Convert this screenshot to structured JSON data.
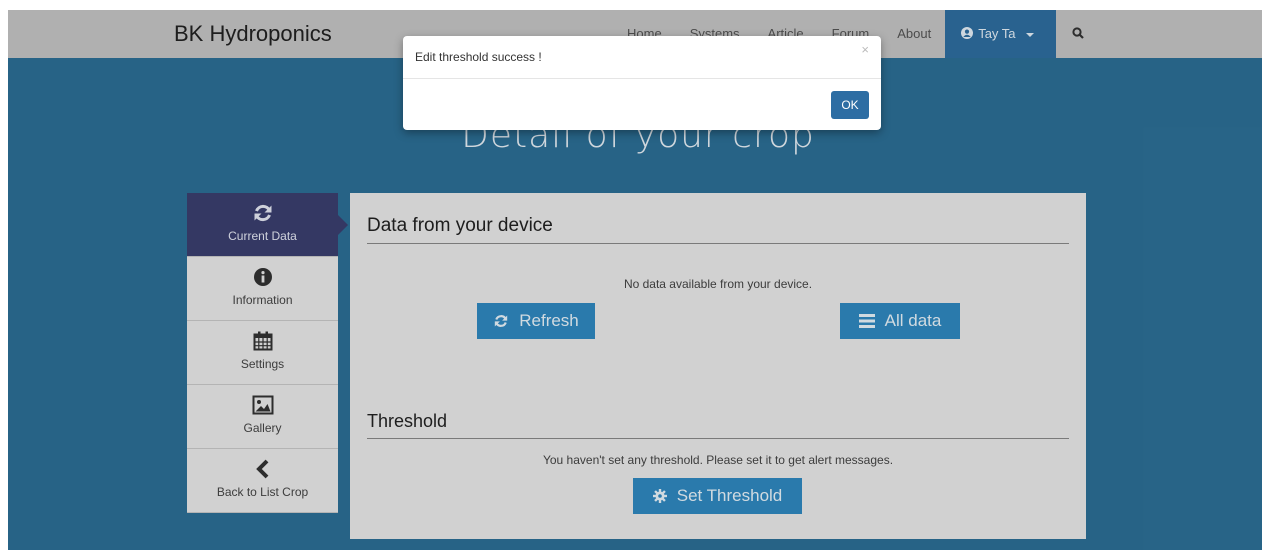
{
  "navbar": {
    "brand": "BK Hydroponics",
    "items": [
      "Home",
      "Systems",
      "Article",
      "Forum",
      "About"
    ],
    "user_name": "Tay Ta",
    "user_icon": "user-circle-icon",
    "search_icon": "search-icon"
  },
  "page": {
    "heading": "Detail of your crop"
  },
  "sidebar": {
    "items": [
      {
        "label": "Current Data",
        "icon": "refresh-icon",
        "active": true
      },
      {
        "label": "Information",
        "icon": "info-icon"
      },
      {
        "label": "Settings",
        "icon": "calendar-icon"
      },
      {
        "label": "Gallery",
        "icon": "image-icon"
      },
      {
        "label": "Back to List Crop",
        "icon": "chevron-left-icon"
      }
    ]
  },
  "data_section": {
    "title": "Data from your device",
    "message": "No data available from your device.",
    "refresh_label": "Refresh",
    "all_data_label": "All data"
  },
  "threshold_section": {
    "title": "Threshold",
    "message": "You haven't set any threshold. Please set it to get alert messages.",
    "set_label": "Set Threshold"
  },
  "modal": {
    "title": "Edit threshold success !",
    "close": "×",
    "ok_label": "OK"
  },
  "colors": {
    "navbar": "#c4c4c4",
    "page_bg": "#2c6f96",
    "sidebar_active": "#3a3f6f",
    "button": "#2f88c0",
    "user_nav": "#2e6ea0"
  }
}
